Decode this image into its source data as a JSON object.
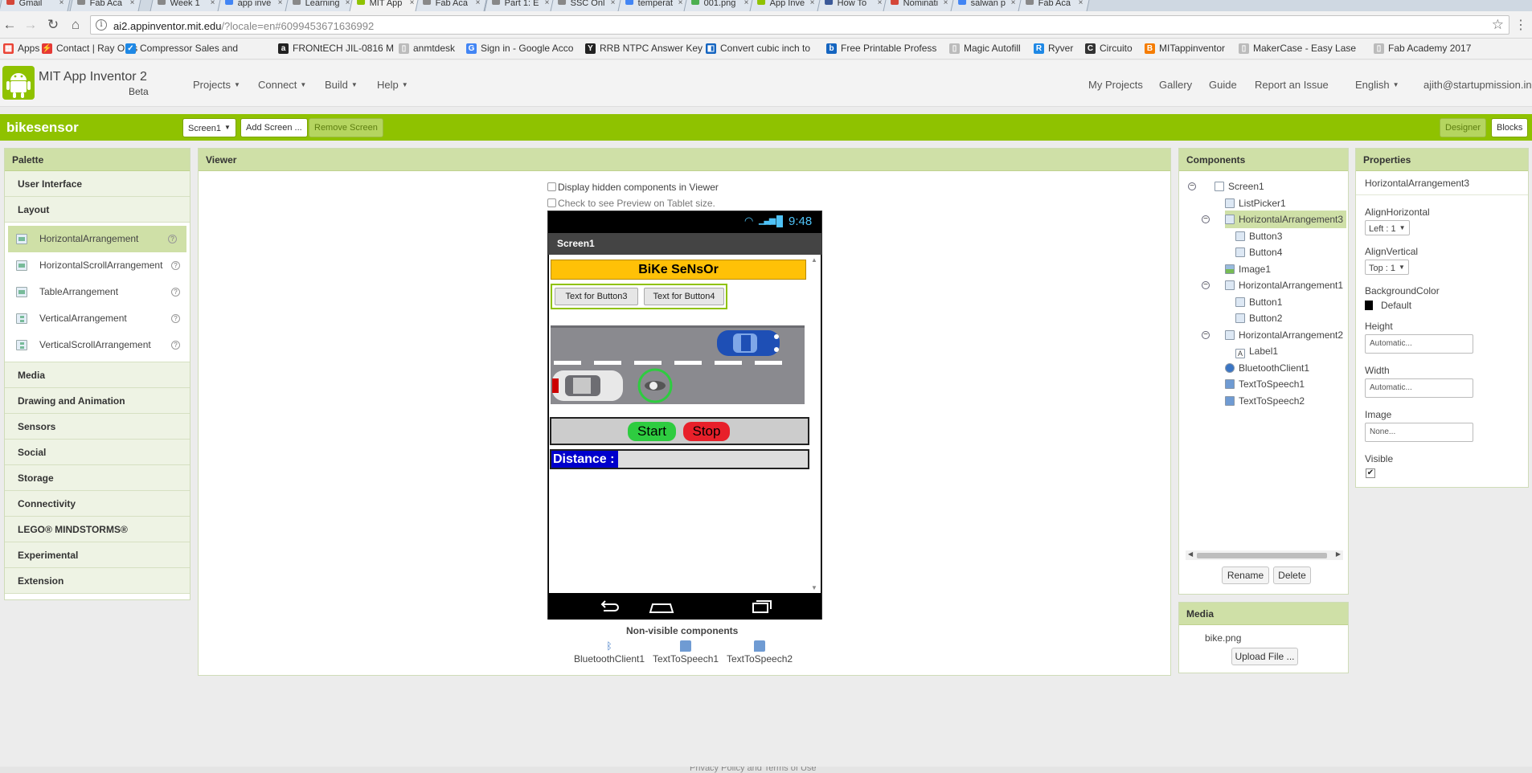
{
  "browser": {
    "tabs": [
      {
        "label": "Gmail",
        "color": "#d44638"
      },
      {
        "label": "Fab Aca",
        "color": "#888888"
      },
      {
        "label": "Week 1",
        "color": "#888888"
      },
      {
        "label": "app inve",
        "color": "#4285f4"
      },
      {
        "label": "Learning",
        "color": "#888888"
      },
      {
        "label": "MIT App",
        "color": "#8fc200"
      },
      {
        "label": "Fab Aca",
        "color": "#888888"
      },
      {
        "label": "Part 1: E",
        "color": "#888888"
      },
      {
        "label": "SSC Onl",
        "color": "#888888"
      },
      {
        "label": "temperat",
        "color": "#4285f4"
      },
      {
        "label": "001.png",
        "color": "#4caf50"
      },
      {
        "label": "App Inve",
        "color": "#8fc200"
      },
      {
        "label": "How To",
        "color": "#3b5998"
      },
      {
        "label": "Nominati",
        "color": "#d44638"
      },
      {
        "label": "salwan p",
        "color": "#4285f4"
      },
      {
        "label": "Fab Aca",
        "color": "#888888"
      }
    ],
    "url_host": "ai2.appinventor.mit.edu",
    "url_rest": "/?locale=en#6099453671636992",
    "bookmarks": [
      {
        "label": "Apps",
        "color": "#ea4335",
        "glyph": "▦"
      },
      {
        "label": "Contact | Ray OMs",
        "color": "#e53935",
        "glyph": "⚡"
      },
      {
        "label": "Compressor Sales and",
        "color": "#1e88e5",
        "glyph": "✓"
      },
      {
        "label": "FRONtECH JIL-0816 M",
        "color": "#222222",
        "glyph": "a"
      },
      {
        "label": "anmtdesk",
        "color": "#bbbbbb",
        "glyph": "▯"
      },
      {
        "label": "Sign in - Google Acco",
        "color": "#4285f4",
        "glyph": "G"
      },
      {
        "label": "RRB NTPC Answer Key",
        "color": "#222222",
        "glyph": "Y"
      },
      {
        "label": "Convert cubic inch to",
        "color": "#1565c0",
        "glyph": "◧"
      },
      {
        "label": "Free Printable Profess",
        "color": "#1565c0",
        "glyph": "b"
      },
      {
        "label": "Magic Autofill",
        "color": "#bbbbbb",
        "glyph": "▯"
      },
      {
        "label": "Ryver",
        "color": "#1e88e5",
        "glyph": "R"
      },
      {
        "label": "Circuito",
        "color": "#333333",
        "glyph": "C"
      },
      {
        "label": "MITappinventor",
        "color": "#f57c00",
        "glyph": "B"
      },
      {
        "label": "MakerCase - Easy Lase",
        "color": "#bbbbbb",
        "glyph": "▯"
      },
      {
        "label": "Fab Academy 2017",
        "color": "#bbbbbb",
        "glyph": "▯"
      }
    ]
  },
  "app": {
    "name": "MIT App Inventor 2",
    "beta": "Beta",
    "menus": [
      "Projects",
      "Connect",
      "Build",
      "Help"
    ],
    "right_links": [
      "My Projects",
      "Gallery",
      "Guide",
      "Report an Issue"
    ],
    "language": "English",
    "user": "ajith@startupmission.in"
  },
  "project": {
    "name": "bikesensor",
    "screen_select": "Screen1",
    "add_screen": "Add Screen ...",
    "remove_screen": "Remove Screen",
    "designer": "Designer",
    "blocks": "Blocks"
  },
  "palette": {
    "title": "Palette",
    "categories_top": [
      "User Interface",
      "Layout"
    ],
    "layout_items": [
      "HorizontalArrangement",
      "HorizontalScrollArrangement",
      "TableArrangement",
      "VerticalArrangement",
      "VerticalScrollArrangement"
    ],
    "categories_bottom": [
      "Media",
      "Drawing and Animation",
      "Sensors",
      "Social",
      "Storage",
      "Connectivity",
      "LEGO® MINDSTORMS®",
      "Experimental",
      "Extension"
    ]
  },
  "viewer": {
    "title": "Viewer",
    "hidden_check": "Display hidden components in Viewer",
    "tablet_check": "Check to see Preview on Tablet size.",
    "clock": "9:48",
    "screen_title": "Screen1",
    "app_title": "BiKe SeNsOr",
    "button3": "Text for Button3",
    "button4": "Text for Button4",
    "start": "Start",
    "stop": "Stop",
    "distance_label": "Distance :",
    "nonvisible_title": "Non-visible components",
    "nonvisible": [
      "BluetoothClient1",
      "TextToSpeech1",
      "TextToSpeech2"
    ]
  },
  "components": {
    "title": "Components",
    "tree": [
      {
        "label": "Screen1",
        "level": 0,
        "toggle": true
      },
      {
        "label": "ListPicker1",
        "level": 1
      },
      {
        "label": "HorizontalArrangement3",
        "level": 1,
        "toggle": true,
        "selected": true
      },
      {
        "label": "Button3",
        "level": 2
      },
      {
        "label": "Button4",
        "level": 2
      },
      {
        "label": "Image1",
        "level": 1
      },
      {
        "label": "HorizontalArrangement1",
        "level": 1,
        "toggle": true
      },
      {
        "label": "Button1",
        "level": 2
      },
      {
        "label": "Button2",
        "level": 2
      },
      {
        "label": "HorizontalArrangement2",
        "level": 1,
        "toggle": true
      },
      {
        "label": "Label1",
        "level": 2
      },
      {
        "label": "BluetoothClient1",
        "level": 1
      },
      {
        "label": "TextToSpeech1",
        "level": 1
      },
      {
        "label": "TextToSpeech2",
        "level": 1
      }
    ],
    "rename": "Rename",
    "delete": "Delete"
  },
  "media": {
    "title": "Media",
    "file": "bike.png",
    "upload": "Upload File ..."
  },
  "properties": {
    "title": "Properties",
    "component": "HorizontalArrangement3",
    "align_h_label": "AlignHorizontal",
    "align_h_value": "Left : 1",
    "align_v_label": "AlignVertical",
    "align_v_value": "Top : 1",
    "bg_label": "BackgroundColor",
    "bg_value": "Default",
    "height_label": "Height",
    "height_value": "Automatic...",
    "width_label": "Width",
    "width_value": "Automatic...",
    "image_label": "Image",
    "image_value": "None...",
    "visible_label": "Visible"
  },
  "footer": "Privacy Policy and Terms of Use",
  "colors": {
    "accent": "#8fc200",
    "title_bar": "#ffc107",
    "start": "#2ecc40",
    "stop": "#e8202a",
    "distance": "#0000cc"
  }
}
